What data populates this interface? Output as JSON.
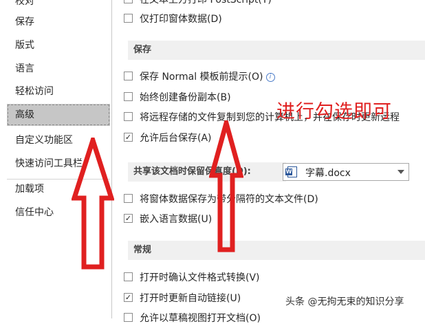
{
  "sidebar": {
    "items": [
      {
        "label": "校对"
      },
      {
        "label": "保存"
      },
      {
        "label": "版式"
      },
      {
        "label": "语言"
      },
      {
        "label": "轻松访问"
      },
      {
        "label": "高级"
      },
      {
        "label": "自定义功能区"
      },
      {
        "label": "快速访问工具栏"
      },
      {
        "label": "加载项"
      },
      {
        "label": "信任中心"
      }
    ],
    "selected_index": 5
  },
  "main": {
    "top_options": [
      {
        "label": "在文本上方打印 PostScript(T)",
        "checked": false
      },
      {
        "label": "仅打印窗体数据(D)",
        "checked": false
      }
    ],
    "sections": [
      {
        "title": "保存",
        "options": [
          {
            "label": "保存 Normal 模板前提示(O)",
            "checked": false
          },
          {
            "label": "始终创建备份副本(B)",
            "checked": false
          },
          {
            "label": "将远程存储的文件复制到您的计算机上，并在保存时更新远程",
            "checked": false
          },
          {
            "label": "允许后台保存(A)",
            "checked": true
          }
        ]
      },
      {
        "title": "共享该文档时保留保真度(D):",
        "dropdown_value": "字幕.docx",
        "options": [
          {
            "label": "将窗体数据保存为带分隔符的文本文件(D)",
            "checked": false
          },
          {
            "label": "嵌入语言数据(U)",
            "checked": true
          }
        ]
      },
      {
        "title": "常规",
        "options": [
          {
            "label": "打开时确认文件格式转换(V)",
            "checked": false
          },
          {
            "label": "打开时更新自动链接(U)",
            "checked": true
          },
          {
            "label": "允许以草稿视图打开文档(O)",
            "checked": false
          }
        ]
      }
    ]
  },
  "annotation": {
    "text": "进行勾选即可",
    "color": "#e02020"
  },
  "watermark": {
    "text": "头条 @无拘无束的知识分享"
  },
  "icons": {
    "info": "info-icon",
    "check": "✓",
    "document": "word-document-icon"
  }
}
